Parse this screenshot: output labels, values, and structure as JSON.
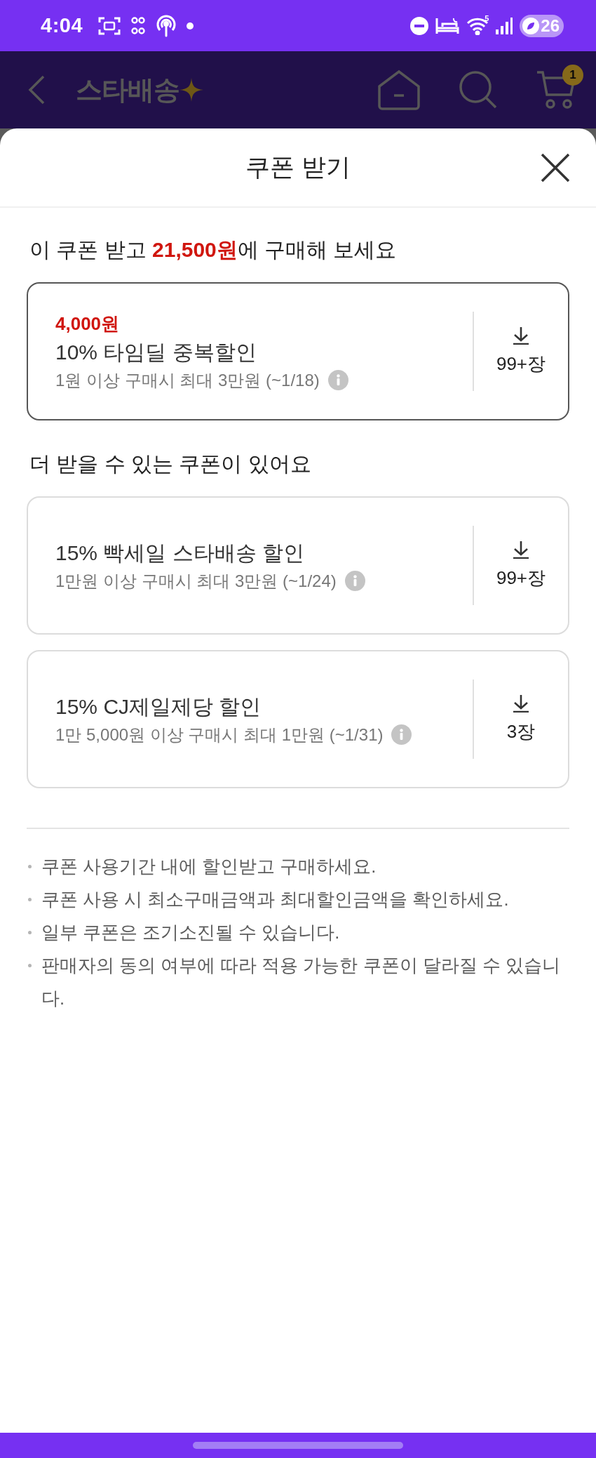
{
  "status_bar": {
    "time": "4:04",
    "wifi_label": "5",
    "battery": "26"
  },
  "header": {
    "logo": "스타배송",
    "cart_count": "1"
  },
  "sheet": {
    "title": "쿠폰 받기"
  },
  "sections": [
    {
      "heading": "이 쿠폰 받고 **21,500원**에 구매해 보세요",
      "coupons": [
        {
          "amount": "4,000원",
          "title": "10% 타임딜 중복할인",
          "condition": "1원 이상 구매시 최대 3만원 (~1/18)",
          "count": "99+장",
          "selected": true
        }
      ]
    },
    {
      "heading": "더 받을 수 있는 쿠폰이 있어요",
      "coupons": [
        {
          "title": "15% 빡세일 스타배송 할인",
          "condition": "1만원 이상 구매시 최대 3만원 (~1/24)",
          "count": "99+장",
          "selected": false
        },
        {
          "title": "15% CJ제일제당 할인",
          "condition": "1만 5,000원 이상 구매시 최대 1만원 (~1/31)",
          "count": "3장",
          "selected": false
        }
      ]
    }
  ],
  "notes": [
    "쿠폰 사용기간 내에 할인받고 구매하세요.",
    "쿠폰 사용 시 최소구매금액과 최대할인금액을 확인하세요.",
    "일부 쿠폰은 조기소진될 수 있습니다.",
    "판매자의 동의 여부에 따라 적용 가능한 쿠폰이 달라질 수 있습니다."
  ]
}
